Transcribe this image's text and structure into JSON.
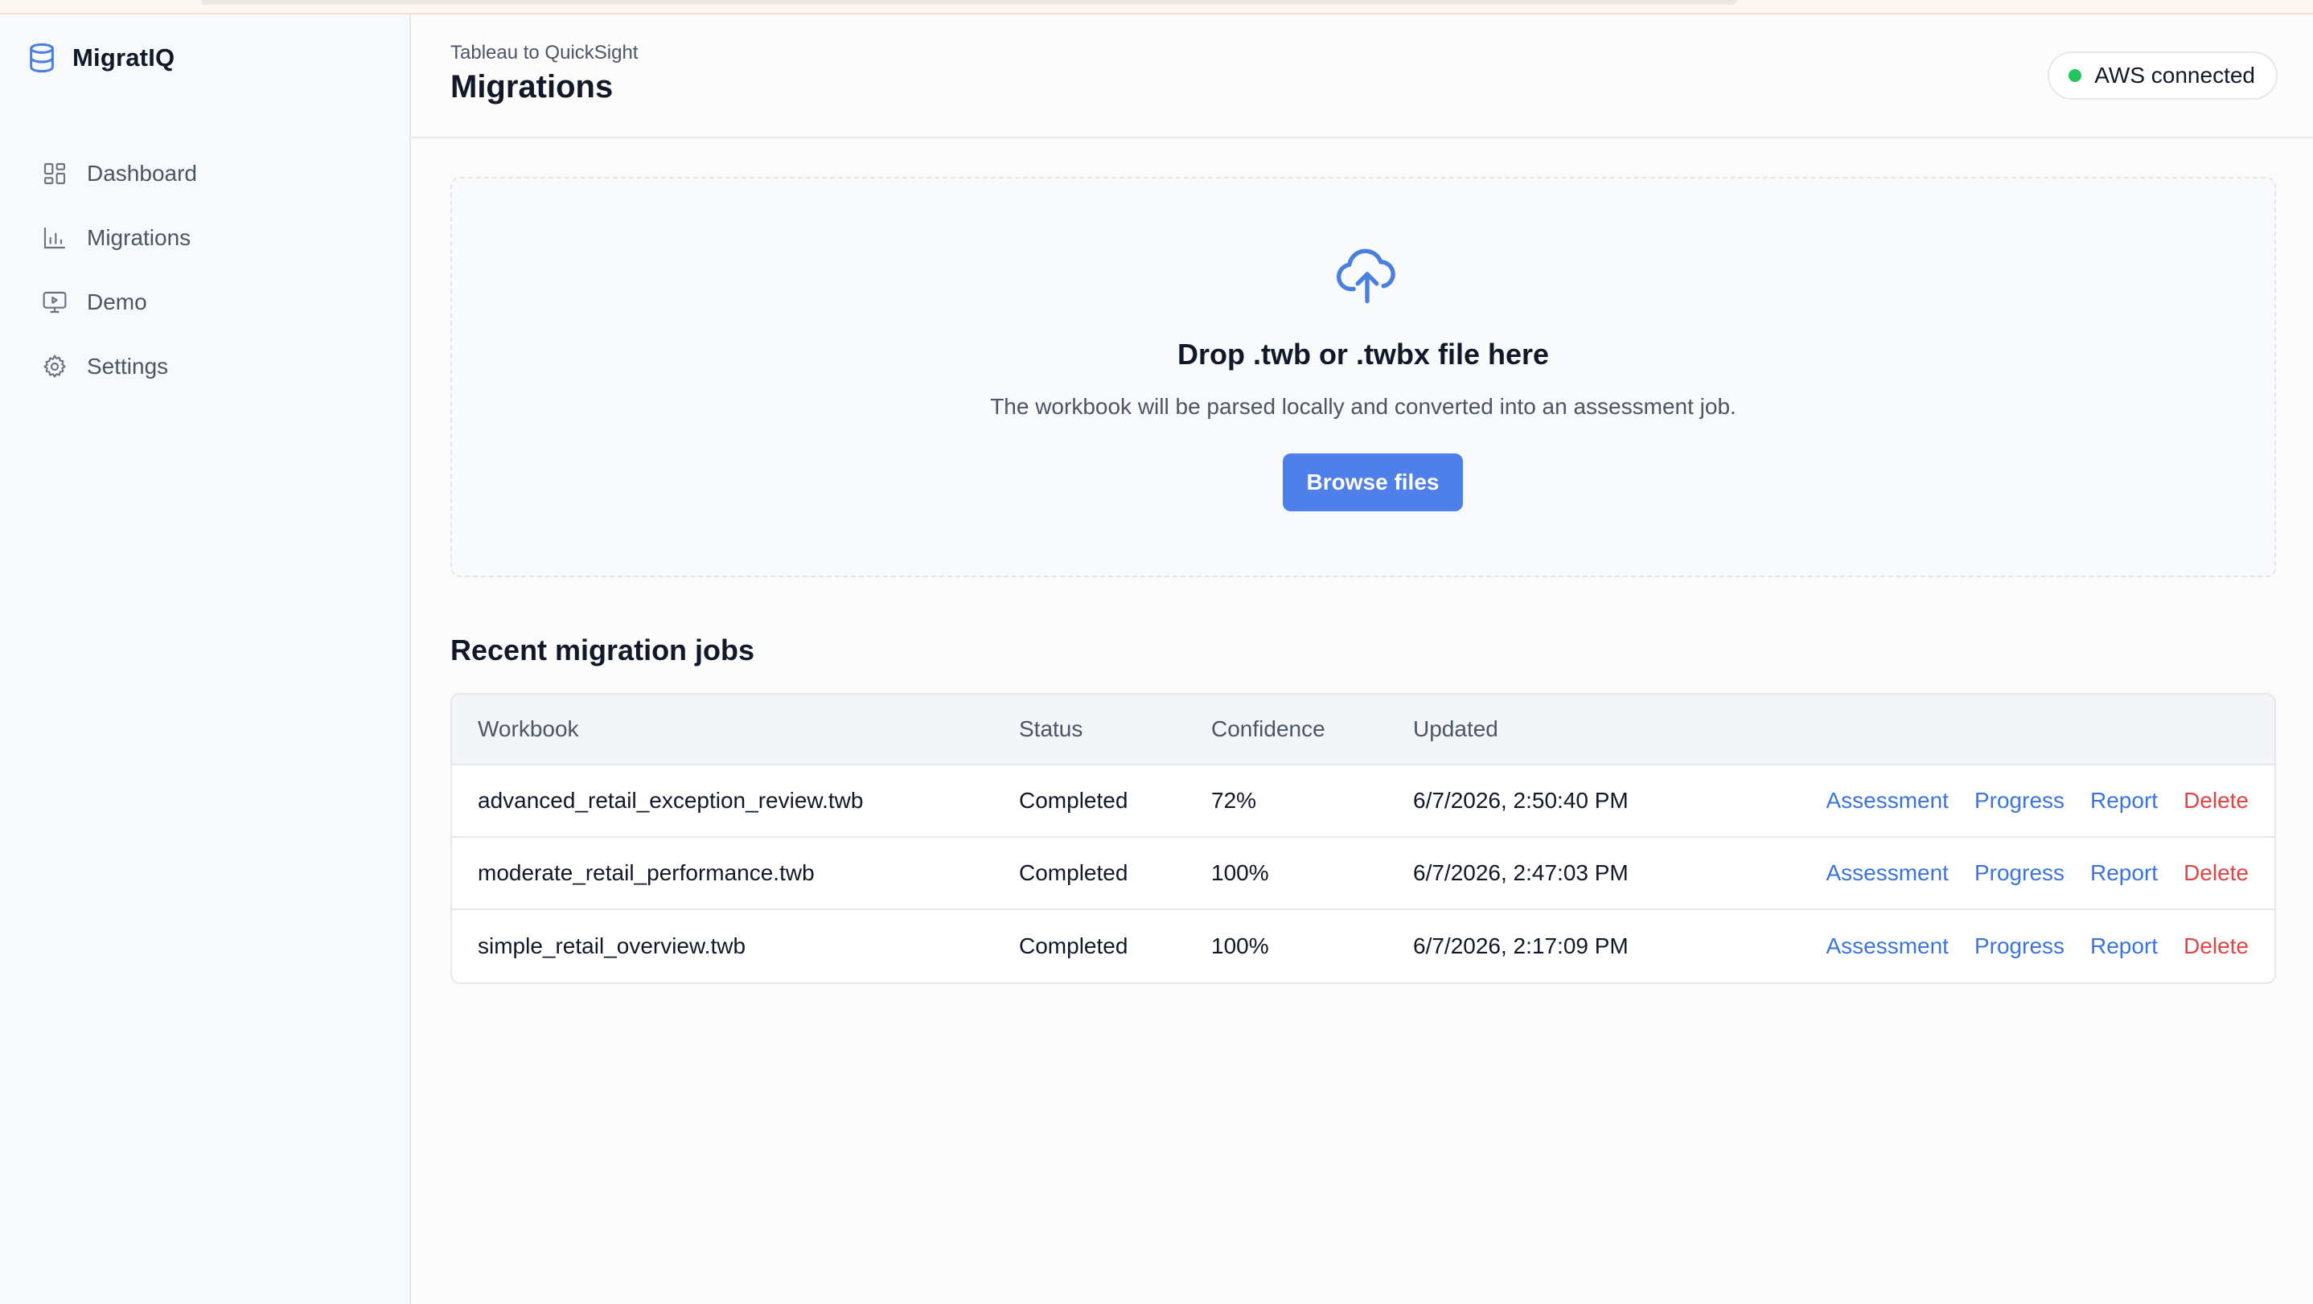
{
  "app": {
    "name": "MigratIQ",
    "brand_color": "#4a7fe0"
  },
  "sidebar": {
    "items": [
      {
        "label": "Dashboard",
        "icon": "dashboard-grid-icon"
      },
      {
        "label": "Migrations",
        "icon": "bar-chart-icon"
      },
      {
        "label": "Demo",
        "icon": "monitor-play-icon"
      },
      {
        "label": "Settings",
        "icon": "gear-icon"
      }
    ]
  },
  "header": {
    "subtitle": "Tableau to QuickSight",
    "title": "Migrations",
    "status_badge": {
      "label": "AWS connected",
      "status_color": "#22c55e"
    }
  },
  "dropzone": {
    "icon": "cloud-upload-icon",
    "title": "Drop .twb or .twbx file here",
    "description": "The workbook will be parsed locally and converted into an assessment job.",
    "button_label": "Browse files"
  },
  "jobs": {
    "title": "Recent migration jobs",
    "columns": [
      "Workbook",
      "Status",
      "Confidence",
      "Updated"
    ],
    "actions": [
      "Assessment",
      "Progress",
      "Report",
      "Delete"
    ],
    "rows": [
      {
        "workbook": "advanced_retail_exception_review.twb",
        "status": "Completed",
        "confidence": "72%",
        "updated": "6/7/2026, 2:50:40 PM"
      },
      {
        "workbook": "moderate_retail_performance.twb",
        "status": "Completed",
        "confidence": "100%",
        "updated": "6/7/2026, 2:47:03 PM"
      },
      {
        "workbook": "simple_retail_overview.twb",
        "status": "Completed",
        "confidence": "100%",
        "updated": "6/7/2026, 2:17:09 PM"
      }
    ]
  }
}
